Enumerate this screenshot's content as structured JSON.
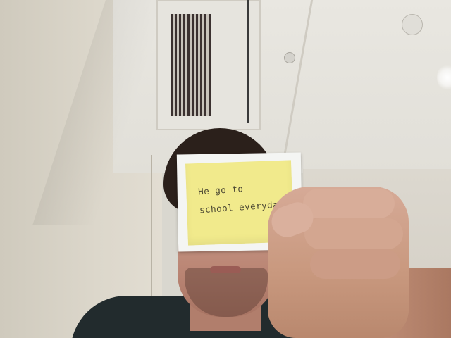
{
  "image": {
    "type": "photo",
    "note": {
      "lines": [
        "He go to",
        "school everyday."
      ],
      "paper_color": "#f1ea8c"
    },
    "colors": {
      "ceiling": "#e6e4de",
      "wall": "#dcd7cb",
      "shirt": "#222b2d",
      "hair": "#2b201b"
    }
  }
}
